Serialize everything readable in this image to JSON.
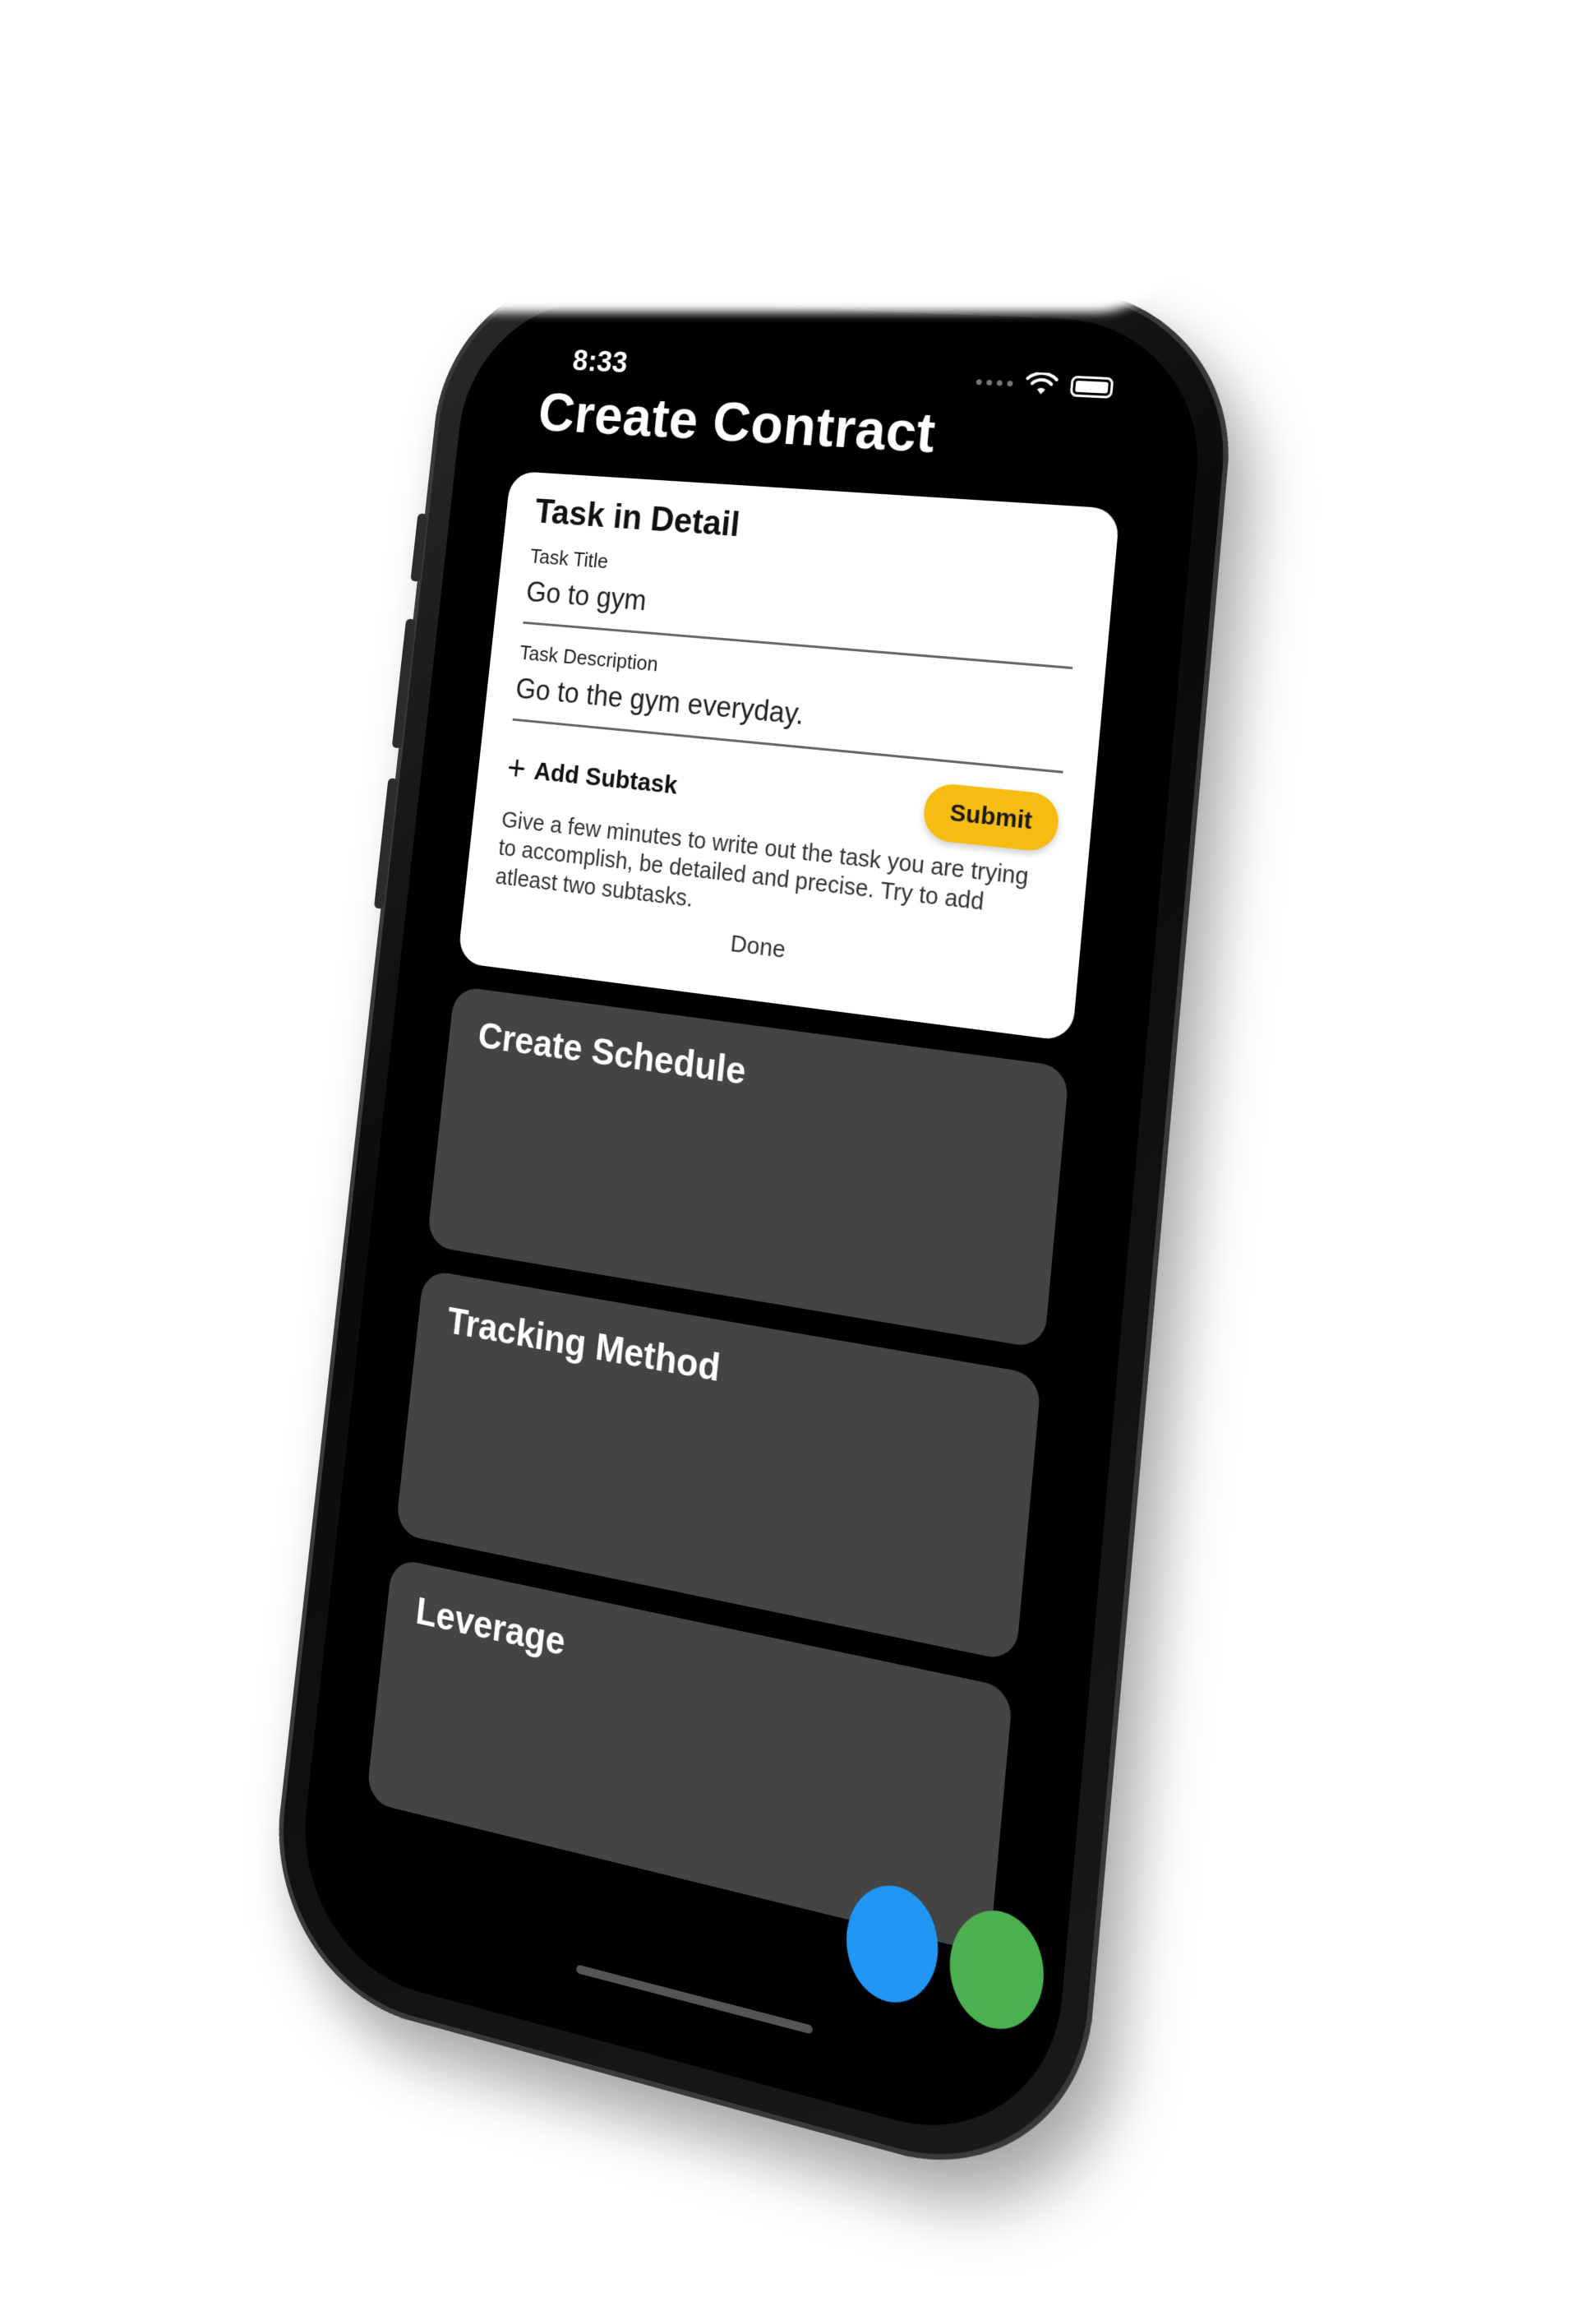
{
  "status_bar": {
    "time": "8:33"
  },
  "header": {
    "title": "Create Contract"
  },
  "task_detail": {
    "heading": "Task in Detail",
    "task_title_label": "Task Title",
    "task_title_value": "Go to gym",
    "task_description_label": "Task Description",
    "task_description_value": "Go to the gym everyday.",
    "add_subtask_label": "Add Subtask",
    "submit_label": "Submit",
    "helper_text": "Give a few minutes to write out the task you are trying to accomplish, be detailed and precise. Try to add atleast two subtasks.",
    "done_label": "Done"
  },
  "sections": [
    {
      "title": "Create Schedule"
    },
    {
      "title": "Tracking Method"
    },
    {
      "title": "Leverage"
    }
  ],
  "colors": {
    "screen_background": "#000000",
    "card_dark": "#444444",
    "submit_yellow": "#f7bc12",
    "fab_blue": "#2196f3",
    "fab_green": "#4caf50"
  },
  "icons": {
    "add_subtask": "plus-icon",
    "wifi": "wifi-icon",
    "battery": "battery-icon",
    "signal": "signal-dots-icon"
  }
}
